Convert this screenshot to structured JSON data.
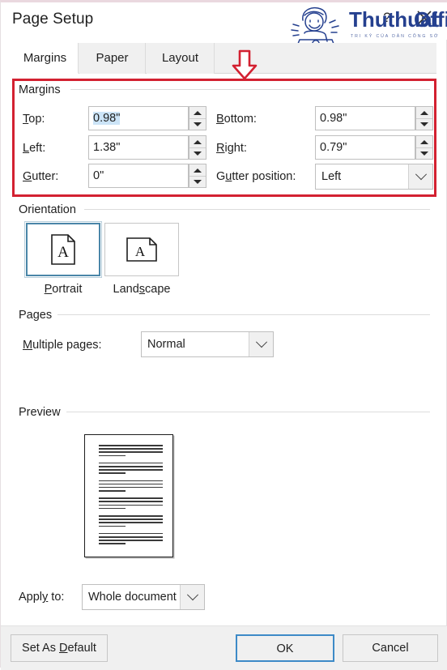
{
  "dialog": {
    "title": "Page Setup",
    "help_icon": "?",
    "close_icon": "close-icon"
  },
  "branding": {
    "name": "ThuthuatOffice",
    "name_part1": "Thuthuat",
    "name_part2": "Office",
    "tagline": "TRI KỶ CỦA DÂN CÔNG SỞ",
    "accent_color": "#25408f"
  },
  "annotation": {
    "box_color": "#d32131",
    "arrow_color": "#d32131",
    "arrow_icon": "down-arrow-icon"
  },
  "tabs": [
    {
      "label": "Margins",
      "active": true
    },
    {
      "label": "Paper",
      "active": false
    },
    {
      "label": "Layout",
      "active": false
    }
  ],
  "margins": {
    "group_label": "Margins",
    "top": {
      "label": "Top:",
      "accel": "T",
      "value": "0.98\"",
      "selected": true
    },
    "bottom": {
      "label": "Bottom:",
      "accel": "B",
      "value": "0.98\""
    },
    "left": {
      "label": "Left:",
      "accel": "L",
      "value": "1.38\""
    },
    "right": {
      "label": "Right:",
      "accel": "R",
      "value": "0.79\""
    },
    "gutter": {
      "label": "Gutter:",
      "accel": "G",
      "value": "0\""
    },
    "gutter_position": {
      "label": "Gutter position:",
      "accel": "u",
      "value": "Left"
    },
    "selection_color": "#cce4f7"
  },
  "orientation": {
    "group_label": "Orientation",
    "portrait": {
      "label": "Portrait",
      "accel": "P",
      "selected": true,
      "icon": "page-portrait-icon"
    },
    "landscape": {
      "label": "Landscape",
      "accel": "s",
      "selected": false,
      "icon": "page-landscape-icon"
    },
    "selected_color": "#4a86a8"
  },
  "pages": {
    "group_label": "Pages",
    "multiple_pages": {
      "label": "Multiple pages:",
      "accel": "M",
      "value": "Normal"
    }
  },
  "preview": {
    "group_label": "Preview",
    "apply_to": {
      "label": "Apply to:",
      "accel": "y",
      "value": "Whole document"
    },
    "paragraph_count": 6,
    "lines_per_paragraph": 3
  },
  "footer": {
    "set_as_default": {
      "label": "Set As Default",
      "accel": "D"
    },
    "ok": {
      "label": "OK",
      "primary": true
    },
    "cancel": {
      "label": "Cancel"
    }
  }
}
